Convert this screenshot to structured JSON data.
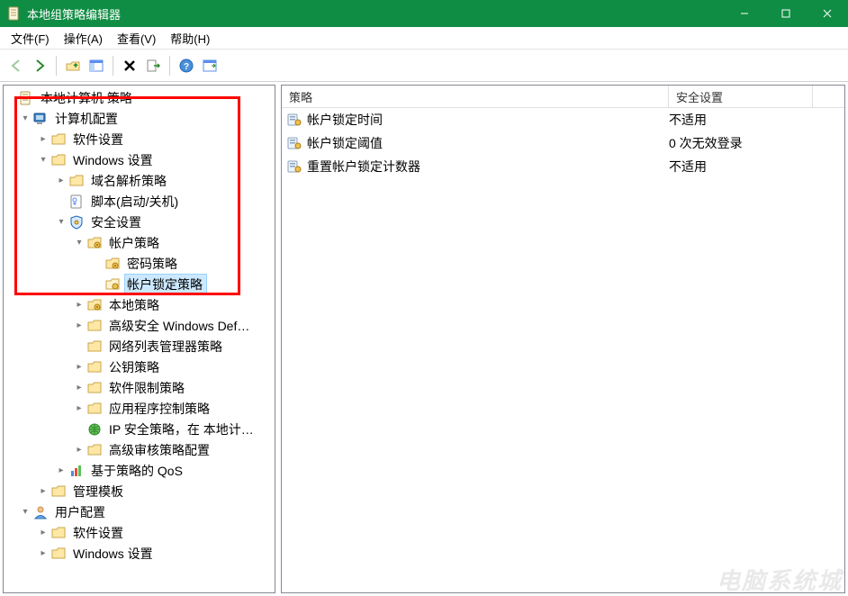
{
  "titlebar": {
    "title": "本地组策略编辑器"
  },
  "menubar": {
    "file": "文件(F)",
    "action": "操作(A)",
    "view": "查看(V)",
    "help": "帮助(H)"
  },
  "toolbar": {
    "back": "back",
    "forward": "forward",
    "up": "up",
    "show_hide_tree": "show-hide-tree",
    "properties": "properties",
    "delete": "delete",
    "export": "export",
    "help": "help",
    "details": "details"
  },
  "tree": {
    "root": "本地计算机 策略",
    "computer_config": "计算机配置",
    "software_settings": "软件设置",
    "windows_settings": "Windows 设置",
    "name_resolution": "域名解析策略",
    "scripts": "脚本(启动/关机)",
    "security_settings": "安全设置",
    "account_policies": "帐户策略",
    "password_policy": "密码策略",
    "account_lockout_policy": "帐户锁定策略",
    "local_policy": "本地策略",
    "adv_firewall": "高级安全 Windows Def…",
    "network_list_mgr": "网络列表管理器策略",
    "public_key": "公钥策略",
    "software_restriction": "软件限制策略",
    "app_control": "应用程序控制策略",
    "ipsec": "IP 安全策略，在 本地计…",
    "adv_audit": "高级审核策略配置",
    "qos": "基于策略的 QoS",
    "admin_templates": "管理模板",
    "user_config": "用户配置",
    "user_software_settings": "软件设置",
    "user_windows_settings": "Windows 设置"
  },
  "list": {
    "columns": {
      "policy": "策略",
      "security_setting": "安全设置"
    },
    "column_widths": {
      "policy": 430,
      "security_setting": 160
    },
    "rows": [
      {
        "policy": "帐户锁定时间",
        "setting": "不适用"
      },
      {
        "policy": "帐户锁定阈值",
        "setting": "0 次无效登录"
      },
      {
        "policy": "重置帐户锁定计数器",
        "setting": "不适用"
      }
    ]
  },
  "watermark": "电脑系统城"
}
